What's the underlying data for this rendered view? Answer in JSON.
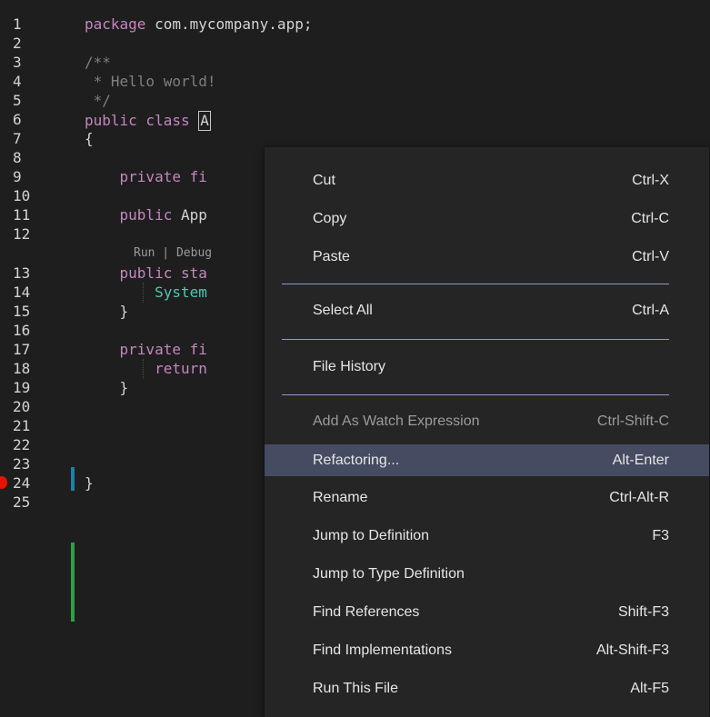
{
  "editor": {
    "line_numbers": [
      "1",
      "2",
      "3",
      "4",
      "5",
      "6",
      "7",
      "8",
      "9",
      "10",
      "11",
      "12",
      "13",
      "14",
      "15",
      "16",
      "17",
      "18",
      "19",
      "20",
      "21",
      "22",
      "23",
      "24",
      "25"
    ],
    "lines": {
      "l1_kw": "package",
      "l1_rest": " com.mycompany.app;",
      "l3": "/**",
      "l4": " * Hello world!",
      "l5": " */",
      "l6_kw1": "public",
      "l6_kw2": " class",
      "l6_sp": " ",
      "l6_cursor": "A",
      "l7": "{",
      "l9_ind": "    ",
      "l9_kw": "private fi",
      "l11_ind": "    ",
      "l11_kw": "public",
      "l11_rest": " App",
      "l13_ind": "    ",
      "l13_kw": "public sta",
      "l14_ind": "        ",
      "l14_ty": "System",
      "l15": "    }",
      "l17_ind": "    ",
      "l17_kw": "private fi",
      "l18_ind": "        ",
      "l18_kw": "return",
      "l19": "    }",
      "l24": "}"
    },
    "codelens": "Run | Debug",
    "colors": {
      "background": "#1e1e1e",
      "keyword": "#c586c0",
      "comment": "#7f7f7f",
      "breakpoint": "#e51400",
      "modified_marker": "#1b81a8",
      "added_marker": "#2ea043"
    }
  },
  "context_menu": {
    "items": [
      {
        "label": "Cut",
        "shortcut": "Ctrl-X"
      },
      {
        "label": "Copy",
        "shortcut": "Ctrl-C"
      },
      {
        "label": "Paste",
        "shortcut": "Ctrl-V"
      },
      {
        "label": "Select All",
        "shortcut": "Ctrl-A"
      },
      {
        "label": "File History",
        "shortcut": ""
      },
      {
        "label": "Add As Watch Expression",
        "shortcut": "Ctrl-Shift-C",
        "disabled": true
      },
      {
        "label": "Refactoring...",
        "shortcut": "Alt-Enter",
        "highlighted": true
      },
      {
        "label": "Rename",
        "shortcut": "Ctrl-Alt-R"
      },
      {
        "label": "Jump to Definition",
        "shortcut": "F3"
      },
      {
        "label": "Jump to Type Definition",
        "shortcut": ""
      },
      {
        "label": "Find References",
        "shortcut": "Shift-F3"
      },
      {
        "label": "Find Implementations",
        "shortcut": "Alt-Shift-F3"
      },
      {
        "label": "Run This File",
        "shortcut": "Alt-F5"
      }
    ],
    "colors": {
      "background": "#252526",
      "highlight": "#454b61",
      "separator": "#8c9bd0",
      "text": "#e6e6e6",
      "disabled_text": "#9b9b9b"
    }
  }
}
